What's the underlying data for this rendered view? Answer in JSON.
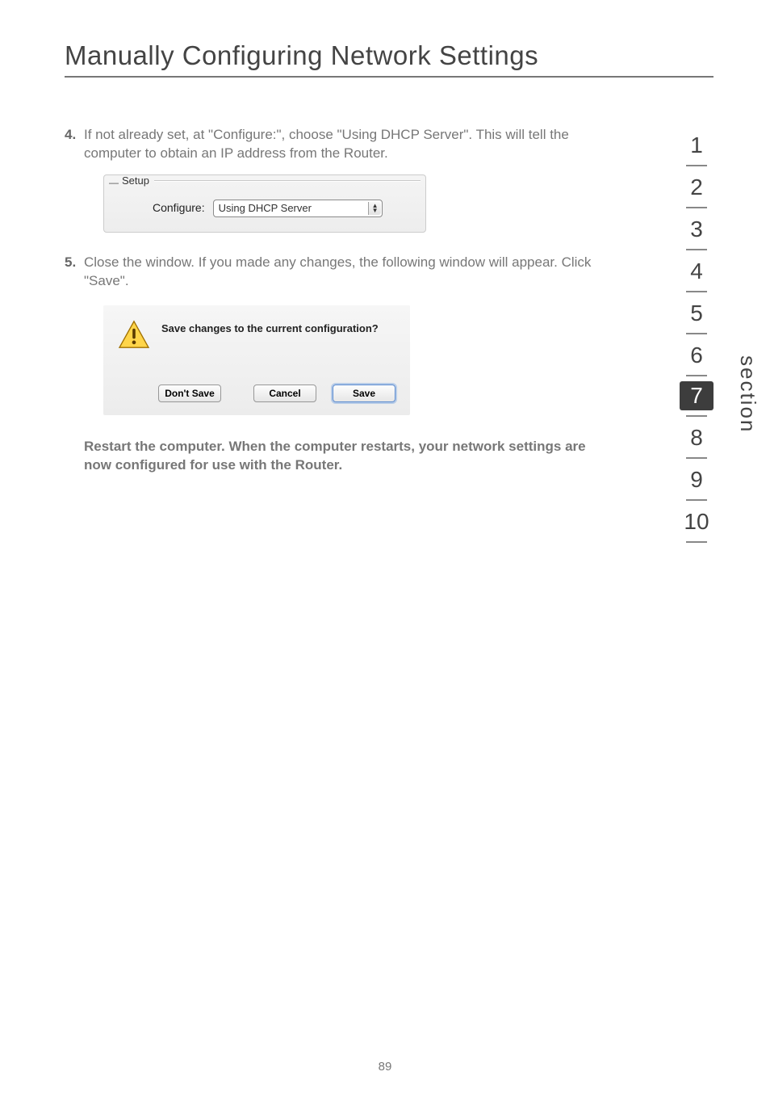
{
  "title": "Manually Configuring Network Settings",
  "steps": [
    {
      "number": "4.",
      "text": "If not already set, at \"Configure:\", choose \"Using DHCP Server\". This will tell the computer to obtain an IP address from the Router."
    },
    {
      "number": "5.",
      "text": "Close the window. If you made any changes, the following window will appear. Click \"Save\"."
    }
  ],
  "setup_box": {
    "group_label": "Setup",
    "configure_label": "Configure:",
    "dropdown_value": "Using DHCP Server"
  },
  "dialog": {
    "message": "Save changes to the current configuration?",
    "buttons": {
      "dont_save": "Don't Save",
      "cancel": "Cancel",
      "save": "Save"
    }
  },
  "restart_note": "Restart the computer. When the computer restarts, your network settings are now configured for use with the Router.",
  "sidenav": [
    "1",
    "2",
    "3",
    "4",
    "5",
    "6",
    "7",
    "8",
    "9",
    "10"
  ],
  "sidenav_active_index": 6,
  "section_label": "section",
  "page_number": "89"
}
